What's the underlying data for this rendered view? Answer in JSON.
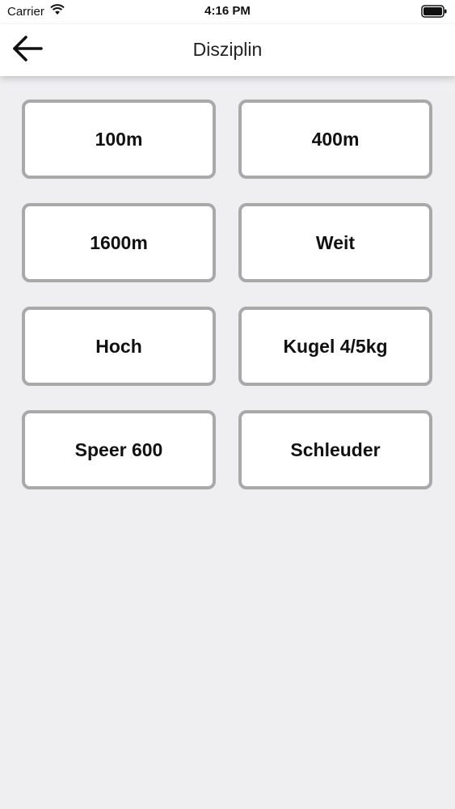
{
  "status_bar": {
    "carrier": "Carrier",
    "time": "4:16 PM",
    "icons": [
      "wifi-icon",
      "battery-icon"
    ]
  },
  "nav": {
    "title": "Disziplin",
    "back_icon": "arrow-left-icon"
  },
  "disciplines": [
    "100m",
    "400m",
    "1600m",
    "Weit",
    "Hoch",
    "Kugel 4/5kg",
    "Speer 600",
    "Schleuder"
  ],
  "colors": {
    "background": "#efeef1",
    "button_border": "#a9a9a9",
    "button_fill": "#ffffff"
  }
}
